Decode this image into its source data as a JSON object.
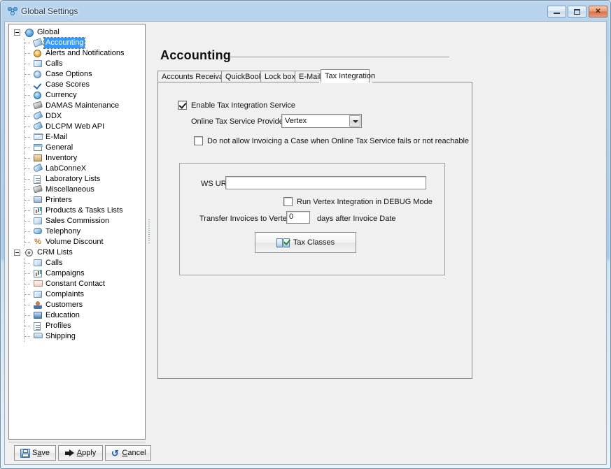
{
  "window": {
    "title": "Global Settings",
    "icon": "molecule-icon",
    "controls": {
      "minimize": "minimize-button",
      "maximize": "maximize-button",
      "close": "close-button"
    }
  },
  "tree": {
    "groups": [
      {
        "label": "Global",
        "icon": "globe-icon",
        "expanded": true,
        "items": [
          {
            "label": "Accounting",
            "icon": "pencil-icon",
            "selected": true
          },
          {
            "label": "Alerts and Notifications",
            "icon": "clock-icon",
            "selected": false
          },
          {
            "label": "Calls",
            "icon": "tag-icon",
            "selected": false
          },
          {
            "label": "Case Options",
            "icon": "gear-icon",
            "selected": false
          },
          {
            "label": "Case Scores",
            "icon": "check-icon",
            "selected": false
          },
          {
            "label": "Currency",
            "icon": "coin-icon",
            "selected": false
          },
          {
            "label": "DAMAS Maintenance",
            "icon": "wrench-icon",
            "selected": false
          },
          {
            "label": "DDX",
            "icon": "key-icon",
            "selected": false
          },
          {
            "label": "DLCPM Web API",
            "icon": "key-icon",
            "selected": false
          },
          {
            "label": "E-Mail",
            "icon": "mail-icon",
            "selected": false
          },
          {
            "label": "General",
            "icon": "window-icon",
            "selected": false
          },
          {
            "label": "Inventory",
            "icon": "box-icon",
            "selected": false
          },
          {
            "label": "LabConneX",
            "icon": "key-icon",
            "selected": false
          },
          {
            "label": "Laboratory Lists",
            "icon": "document-icon",
            "selected": false
          },
          {
            "label": "Miscellaneous",
            "icon": "wrench-icon",
            "selected": false
          },
          {
            "label": "Printers",
            "icon": "printer-icon",
            "selected": false
          },
          {
            "label": "Products & Tasks Lists",
            "icon": "chart-icon",
            "selected": false
          },
          {
            "label": "Sales Commission",
            "icon": "tag-icon",
            "selected": false
          },
          {
            "label": "Telephony",
            "icon": "phone-icon",
            "selected": false
          },
          {
            "label": "Volume Discount",
            "icon": "percent-icon",
            "selected": false
          }
        ]
      },
      {
        "label": "CRM Lists",
        "icon": "target-icon",
        "expanded": true,
        "items": [
          {
            "label": "Calls",
            "icon": "tag-icon",
            "selected": false
          },
          {
            "label": "Campaigns",
            "icon": "chart-icon",
            "selected": false
          },
          {
            "label": "Constant Contact",
            "icon": "envelope-icon",
            "selected": false
          },
          {
            "label": "Complaints",
            "icon": "tag-icon",
            "selected": false
          },
          {
            "label": "Customers",
            "icon": "people-icon",
            "selected": false
          },
          {
            "label": "Education",
            "icon": "cap-icon",
            "selected": false
          },
          {
            "label": "Profiles",
            "icon": "document-icon",
            "selected": false
          },
          {
            "label": "Shipping",
            "icon": "truck-icon",
            "selected": false
          }
        ]
      }
    ]
  },
  "content": {
    "page_title": "Accounting",
    "tabs": [
      {
        "label": "Accounts Receivable",
        "active": false
      },
      {
        "label": "QuickBooks",
        "active": false
      },
      {
        "label": "Lock box",
        "active": false
      },
      {
        "label": "E-Mail",
        "active": false
      },
      {
        "label": "Tax Integration",
        "active": true
      }
    ],
    "tax_integration": {
      "enable_service": {
        "label": "Enable Tax Integration Service",
        "checked": true
      },
      "provider": {
        "label": "Online Tax Service Provider:",
        "value": "Vertex",
        "options": [
          "Vertex"
        ]
      },
      "disallow_invoicing": {
        "label": "Do not allow Invoicing a Case when Online Tax Service fails or not reachable",
        "checked": false
      },
      "ws_url": {
        "label": "WS URL:",
        "value": "",
        "placeholder": ""
      },
      "debug_mode": {
        "label": "Run Vertex Integration in DEBUG Mode",
        "checked": false
      },
      "transfer": {
        "label_before": "Transfer Invoices to Vertex",
        "value": "0",
        "label_after": "days after Invoice Date"
      },
      "tax_classes_button": {
        "label": "Tax Classes",
        "icon": "tax-classes-icon"
      }
    }
  },
  "footer": {
    "buttons": [
      {
        "id": "save",
        "prefix": "S",
        "mnemonic": "a",
        "suffix": "ve",
        "icon": "save-icon"
      },
      {
        "id": "apply",
        "prefix": "",
        "mnemonic": "A",
        "suffix": "pply",
        "icon": "apply-arrow-icon"
      },
      {
        "id": "cancel",
        "prefix": "",
        "mnemonic": "C",
        "suffix": "ancel",
        "icon": "undo-icon"
      }
    ]
  },
  "colors": {
    "titlebar": "#a8cbea",
    "selection": "#3399ff",
    "close_button": "#dd7a52",
    "panel_bg": "#f0f0f0"
  }
}
